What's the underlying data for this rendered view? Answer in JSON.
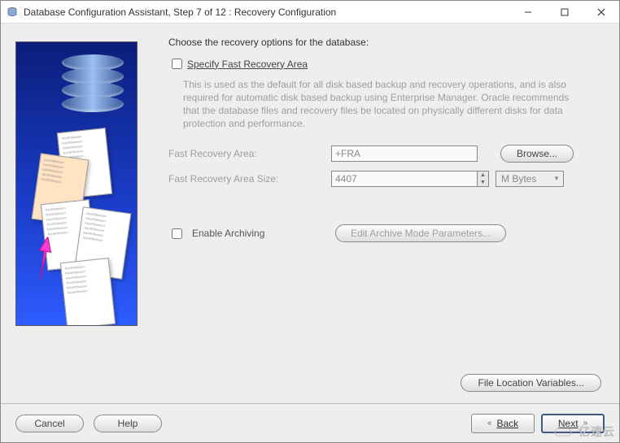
{
  "window": {
    "title": "Database Configuration Assistant, Step 7 of 12 : Recovery Configuration"
  },
  "header": "Choose the recovery options for the database:",
  "specify": {
    "label": "Specify Fast Recovery Area",
    "desc": "This is used as the default for all disk based backup and recovery operations, and is also required for automatic disk based backup using Enterprise Manager. Oracle recommends that the database files and recovery files be located on physically different disks for data protection and performance."
  },
  "fields": {
    "fra_label": "Fast Recovery Area:",
    "fra_value": "+FRA",
    "browse": "Browse...",
    "size_label": "Fast Recovery Area Size:",
    "size_value": "4407",
    "unit": "M Bytes"
  },
  "archiving": {
    "label": "Enable Archiving",
    "edit_btn": "Edit Archive Mode Parameters..."
  },
  "file_loc_btn": "File Location Variables...",
  "footer": {
    "cancel": "Cancel",
    "help": "Help",
    "back": "Back",
    "next": "Next"
  },
  "watermark": "亿速云"
}
